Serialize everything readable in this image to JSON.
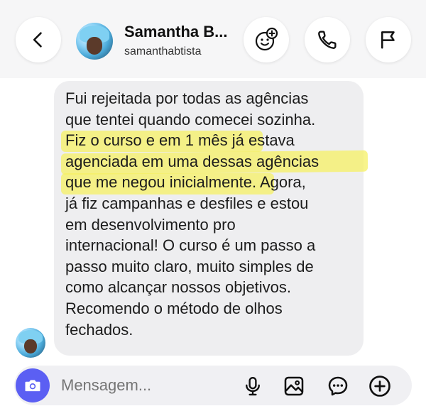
{
  "header": {
    "name": "Samantha B...",
    "username": "samanthabtista",
    "icons": {
      "back": "chevron-left-icon",
      "effects": "face-effects-icon",
      "call": "phone-icon",
      "report": "flag-icon"
    }
  },
  "message": {
    "lines": [
      "Fui rejeitada por todas as agências",
      "que tentei quando comecei sozinha.",
      "Fiz o curso e em 1 mês já estava",
      "agenciada em uma dessas agências",
      "que me negou inicialmente.",
      " Agora,",
      "já fiz campanhas e desfiles e estou",
      "em desenvolvimento pro",
      "internacional! O curso é um passo a",
      "passo muito claro, muito simples de",
      "como alcançar nossos objetivos.",
      "Recomendo o método de olhos",
      "fechados."
    ],
    "highlight_color": "#f6f064"
  },
  "composer": {
    "placeholder": "Mensagem...",
    "accent": "#5b5ff3",
    "icons": [
      "camera-icon",
      "microphone-icon",
      "gallery-icon",
      "sticker-icon",
      "plus-icon"
    ]
  }
}
